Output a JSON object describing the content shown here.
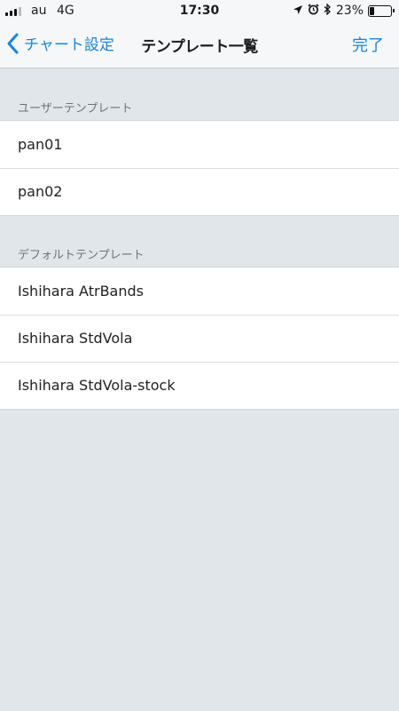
{
  "status_bar": {
    "carrier": "au",
    "network": "4G",
    "time": "17:30",
    "battery_percent": "23%",
    "battery_level": 0.23,
    "icons": [
      "location-arrow-icon",
      "alarm-icon",
      "bluetooth-icon",
      "battery-icon"
    ]
  },
  "nav": {
    "back_label": "チャート設定",
    "title": "テンプレート一覧",
    "done_label": "完了",
    "accent_color": "#1a84d8"
  },
  "sections": [
    {
      "header": "ユーザーテンプレート",
      "items": [
        {
          "label": "pan01"
        },
        {
          "label": "pan02"
        }
      ]
    },
    {
      "header": "デフォルトテンプレート",
      "items": [
        {
          "label": "Ishihara AtrBands"
        },
        {
          "label": "Ishihara StdVola"
        },
        {
          "label": "Ishihara StdVola-stock"
        }
      ]
    }
  ]
}
